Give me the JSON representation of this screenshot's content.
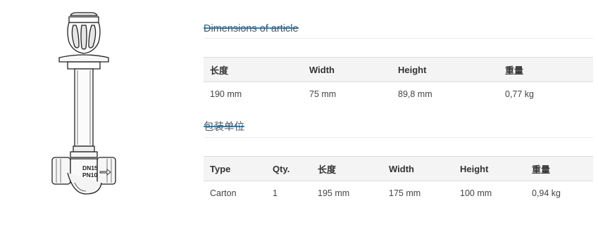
{
  "product": {
    "marking_line1": "DN15",
    "marking_line2": "PN10"
  },
  "dimensions": {
    "tab_label": "Dimensions of article",
    "headers": [
      "长度",
      "Width",
      "Height",
      "重量"
    ],
    "row": [
      "190 mm",
      "75 mm",
      "89,8 mm",
      "0,77 kg"
    ]
  },
  "packaging": {
    "tab_label": "包装单位",
    "headers": [
      "Type",
      "Qty.",
      "长度",
      "Width",
      "Height",
      "重量"
    ],
    "row": [
      "Carton",
      "1",
      "195 mm",
      "175 mm",
      "100 mm",
      "0,94 kg"
    ]
  },
  "colors": {
    "accent": "#1d8ed2",
    "header_bg": "#f4f4f4"
  }
}
